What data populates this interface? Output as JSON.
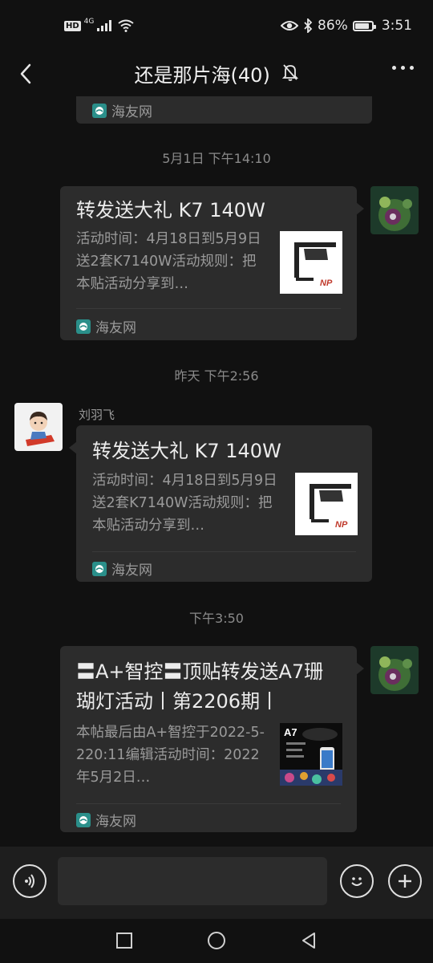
{
  "status_bar": {
    "hd": "HD",
    "network": "4G",
    "battery_percent": "86%",
    "battery_level": 0.86,
    "time": "3:51"
  },
  "header": {
    "title": "还是那片海(40)",
    "icons": [
      "back-arrow-icon",
      "mute-bell-icon",
      "more-dots-icon"
    ]
  },
  "messages": [
    {
      "type": "partial-card-footer",
      "source": "海友网"
    },
    {
      "type": "time",
      "text": "5月1日 下午14:10"
    },
    {
      "type": "link-card",
      "side": "right",
      "title": "转发送大礼 K7 140W",
      "desc": "活动时间：4月18日到5月9日送2套K7140W活动规则：把本贴活动分享到…",
      "source": "海友网"
    },
    {
      "type": "time",
      "text": "昨天 下午2:56"
    },
    {
      "type": "link-card",
      "side": "left",
      "sender": "刘羽飞",
      "title": "转发送大礼 K7 140W",
      "desc": "活动时间：4月18日到5月9日送2套K7140W活动规则：把本贴活动分享到…",
      "source": "海友网"
    },
    {
      "type": "time",
      "text": "下午3:50"
    },
    {
      "type": "link-card",
      "side": "right",
      "title": "〓A+智控〓顶贴转发送A7珊瑚灯活动丨第2206期丨",
      "desc": "本帖最后由A+智控于2022-5-220:11编辑活动时间：2022年5月2日…",
      "source": "海友网",
      "thumb_label": "A7"
    }
  ],
  "thumb_logo": "NP",
  "input_bar": {
    "placeholder": "",
    "icons": [
      "voice-icon",
      "emoji-icon",
      "plus-icon"
    ]
  },
  "system_nav": {
    "icons": [
      "recent-apps-icon",
      "home-icon",
      "back-icon"
    ]
  },
  "colors": {
    "background": "#111111",
    "card": "#2c2c2c",
    "source_icon": "#2a8f8a"
  }
}
